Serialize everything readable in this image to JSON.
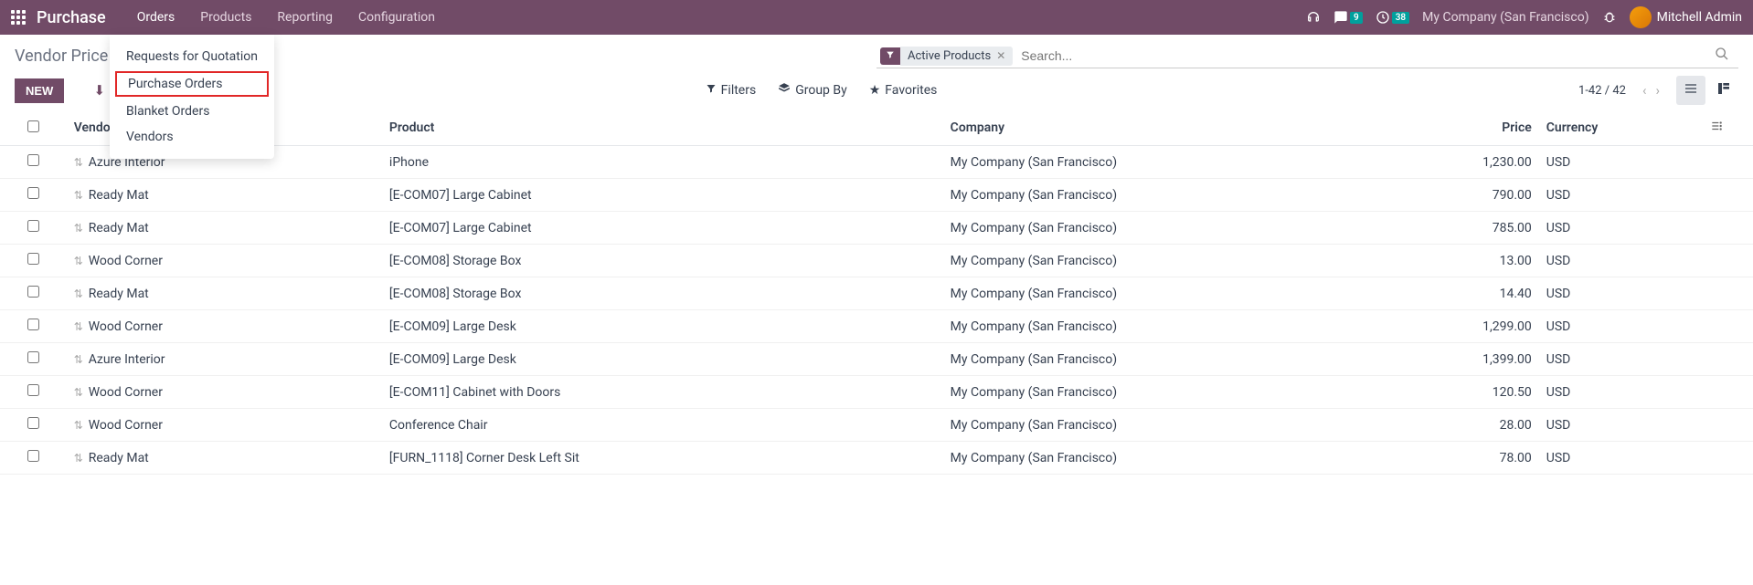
{
  "navbar": {
    "brand": "Purchase",
    "menus": [
      "Orders",
      "Products",
      "Reporting",
      "Configuration"
    ],
    "company": "My Company (San Francisco)",
    "user": "Mitchell Admin",
    "msg_count": "9",
    "activity_count": "38"
  },
  "dropdown": {
    "items": [
      "Requests for Quotation",
      "Purchase Orders",
      "Blanket Orders",
      "Vendors"
    ]
  },
  "breadcrumb": "Vendor Price",
  "buttons": {
    "new": "NEW"
  },
  "search": {
    "facet_label": "Active Products",
    "placeholder": "Search..."
  },
  "toolbar": {
    "filters": "Filters",
    "groupby": "Group By",
    "favorites": "Favorites"
  },
  "pager": "1-42 / 42",
  "columns": {
    "vendor": "Vendor",
    "product": "Product",
    "company": "Company",
    "price": "Price",
    "currency": "Currency"
  },
  "rows": [
    {
      "vendor": "Azure Interior",
      "product": "iPhone",
      "company": "My Company (San Francisco)",
      "price": "1,230.00",
      "currency": "USD"
    },
    {
      "vendor": "Ready Mat",
      "product": "[E-COM07] Large Cabinet",
      "company": "My Company (San Francisco)",
      "price": "790.00",
      "currency": "USD"
    },
    {
      "vendor": "Ready Mat",
      "product": "[E-COM07] Large Cabinet",
      "company": "My Company (San Francisco)",
      "price": "785.00",
      "currency": "USD"
    },
    {
      "vendor": "Wood Corner",
      "product": "[E-COM08] Storage Box",
      "company": "My Company (San Francisco)",
      "price": "13.00",
      "currency": "USD"
    },
    {
      "vendor": "Ready Mat",
      "product": "[E-COM08] Storage Box",
      "company": "My Company (San Francisco)",
      "price": "14.40",
      "currency": "USD"
    },
    {
      "vendor": "Wood Corner",
      "product": "[E-COM09] Large Desk",
      "company": "My Company (San Francisco)",
      "price": "1,299.00",
      "currency": "USD"
    },
    {
      "vendor": "Azure Interior",
      "product": "[E-COM09] Large Desk",
      "company": "My Company (San Francisco)",
      "price": "1,399.00",
      "currency": "USD"
    },
    {
      "vendor": "Wood Corner",
      "product": "[E-COM11] Cabinet with Doors",
      "company": "My Company (San Francisco)",
      "price": "120.50",
      "currency": "USD"
    },
    {
      "vendor": "Wood Corner",
      "product": "Conference Chair",
      "company": "My Company (San Francisco)",
      "price": "28.00",
      "currency": "USD"
    },
    {
      "vendor": "Ready Mat",
      "product": "[FURN_1118] Corner Desk Left Sit",
      "company": "My Company (San Francisco)",
      "price": "78.00",
      "currency": "USD"
    }
  ]
}
